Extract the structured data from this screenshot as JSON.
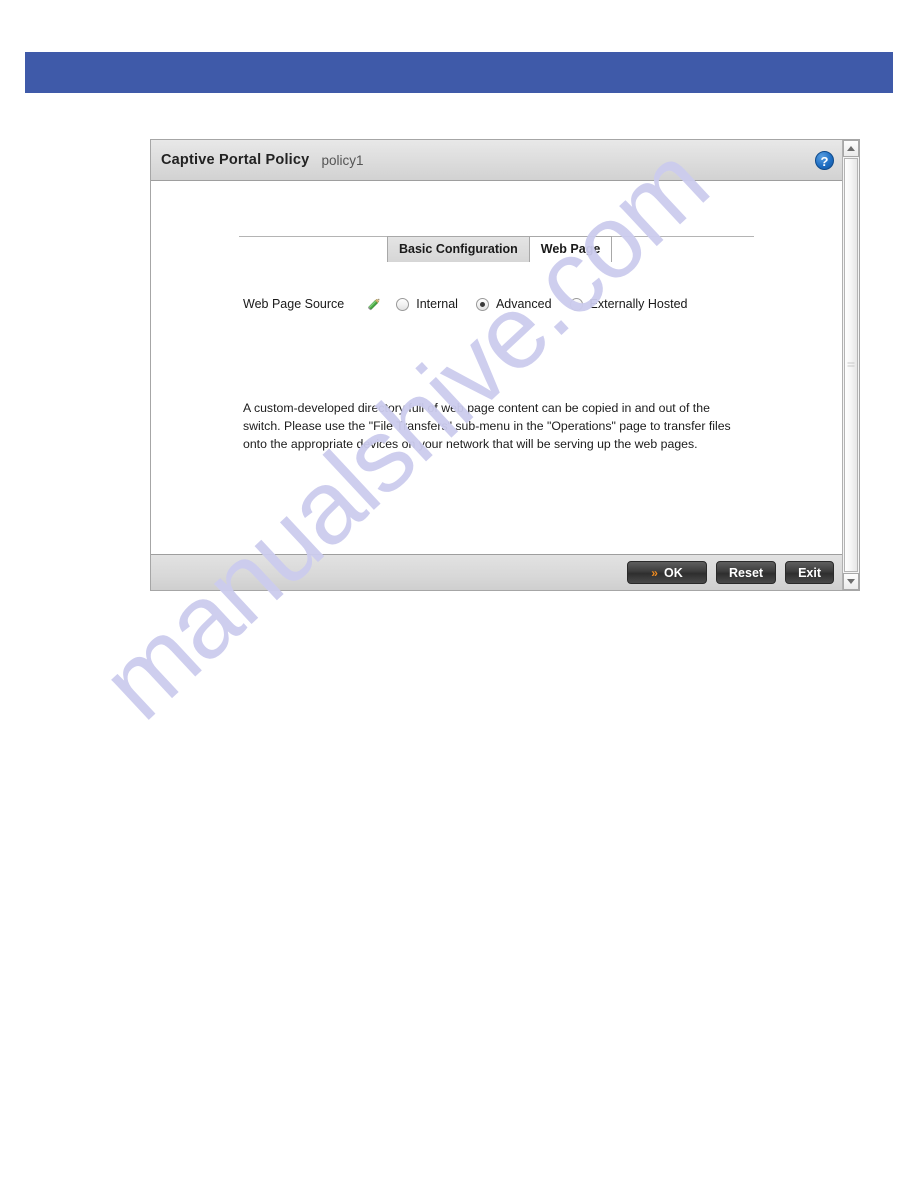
{
  "banner": {
    "name": "top-banner",
    "color": "#3f5aa9",
    "text": ""
  },
  "watermark": {
    "text": "manualshive.com",
    "color": "#ccccee"
  },
  "dialog": {
    "title": "Captive Portal Policy",
    "subtitle": "policy1",
    "help_icon_glyph": "?",
    "tabs": [
      {
        "label": "Basic Configuration",
        "active": false
      },
      {
        "label": "Web Page",
        "active": true
      }
    ],
    "form": {
      "web_page_source": {
        "label": "Web Page Source",
        "edit_icon": "pencil-icon",
        "options": [
          {
            "label": "Internal",
            "selected": false
          },
          {
            "label": "Advanced",
            "selected": true
          },
          {
            "label": "Externally Hosted",
            "selected": false
          }
        ]
      }
    },
    "description": "A custom-developed directory full of web page content can be copied in and out of the switch. Please use the \"File Transfers\" sub-menu in the \"Operations\" page to transfer files onto the appropriate devices on your network that will be serving up the web pages.",
    "footer": {
      "ok_label": "OK",
      "ok_chevron": "»",
      "ok_accent": "#ef8b20",
      "reset_label": "Reset",
      "exit_label": "Exit"
    },
    "scrollbar": {
      "up_arrow": "scroll-up-icon",
      "down_arrow": "scroll-down-icon"
    }
  }
}
